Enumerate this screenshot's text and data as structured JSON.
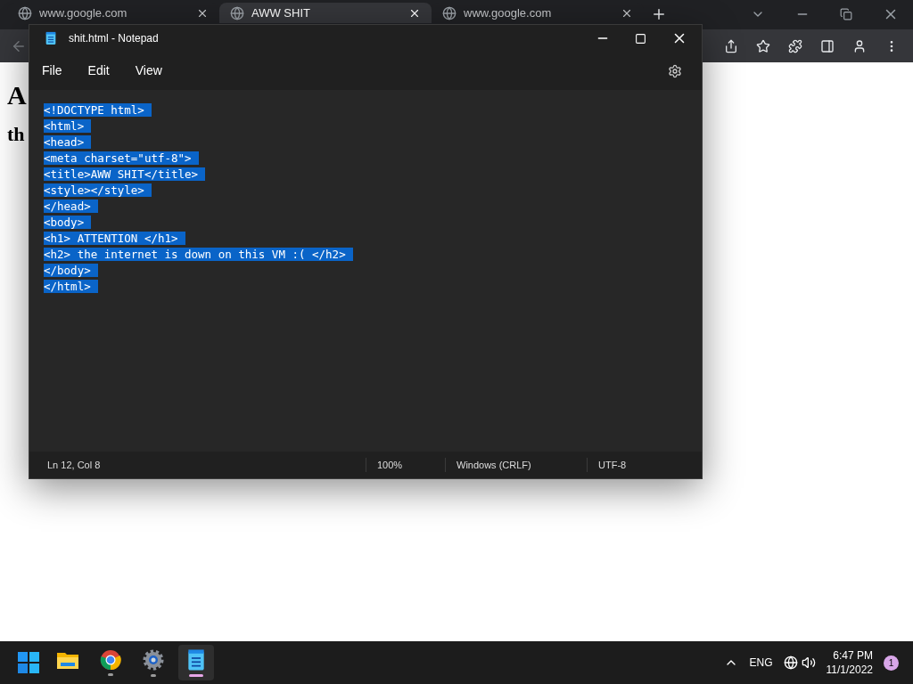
{
  "browser": {
    "tabs": [
      {
        "title": "www.google.com",
        "selected": false
      },
      {
        "title": "AWW SHIT",
        "selected": true
      },
      {
        "title": "www.google.com",
        "selected": false
      }
    ],
    "page": {
      "heading": "A",
      "subheading": "th"
    }
  },
  "notepad": {
    "title": "shit.html - Notepad",
    "menu": [
      "File",
      "Edit",
      "View"
    ],
    "all_selected": true,
    "lines": [
      "<!DOCTYPE html>",
      "<html>",
      "<head>",
      "<meta charset=\"utf-8\">",
      "<title>AWW SHIT</title>",
      "<style></style>",
      "</head>",
      "<body>",
      "<h1> ATTENTION </h1>",
      "<h2> the internet is down on this VM :( </h2>",
      "</body>",
      "</html>"
    ],
    "status": {
      "position": "Ln 12, Col 8",
      "zoom": "100%",
      "line_ending": "Windows (CRLF)",
      "encoding": "UTF-8"
    }
  },
  "taskbar": {
    "apps": [
      {
        "kind": "explorer",
        "running": false,
        "active": false
      },
      {
        "kind": "chrome",
        "running": true,
        "active": false
      },
      {
        "kind": "settings",
        "running": true,
        "active": false
      },
      {
        "kind": "notepad",
        "running": true,
        "active": true
      }
    ],
    "language": "ENG",
    "time": "6:47 PM",
    "date": "11/1/2022",
    "notifications": "1"
  }
}
